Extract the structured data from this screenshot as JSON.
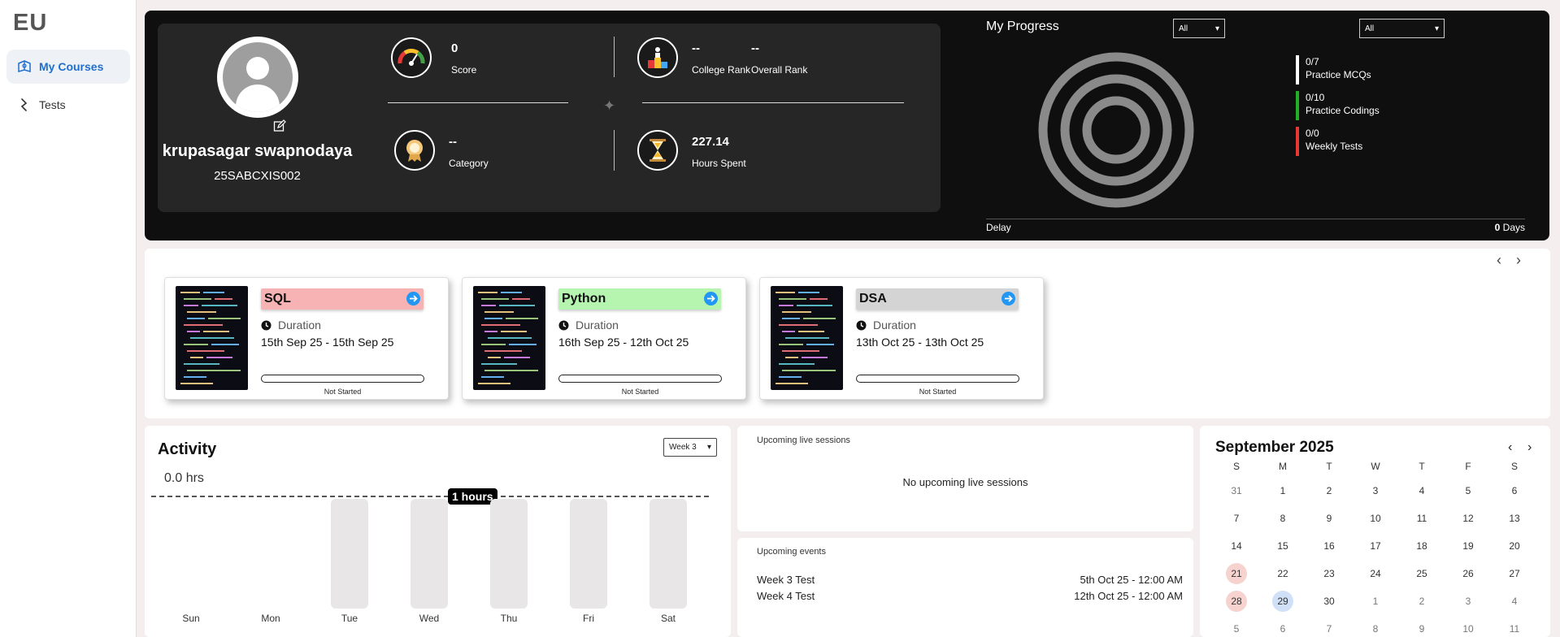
{
  "brand": {
    "logo": "EU"
  },
  "sidebar": {
    "items": [
      {
        "label": "My Courses",
        "icon": "book-icon",
        "active": true
      },
      {
        "label": "Tests",
        "icon": "test-icon",
        "active": false
      }
    ]
  },
  "profile": {
    "name": "krupasagar swapnodaya",
    "id": "25SABCXIS002"
  },
  "stats": {
    "score": {
      "value": "0",
      "label": "Score",
      "icon": "speedometer-icon"
    },
    "college_rank": {
      "value": "--",
      "label": "College Rank",
      "icon": "podium-icon"
    },
    "overall_rank": {
      "value": "--",
      "label": "Overall Rank"
    },
    "category": {
      "value": "--",
      "label": "Category",
      "icon": "medal-icon"
    },
    "hours": {
      "value": "227.14",
      "label": "Hours Spent",
      "icon": "hourglass-icon"
    }
  },
  "progress": {
    "title": "My Progress",
    "filter1": "All",
    "filter2": "All",
    "legend": [
      {
        "value": "0/7",
        "label": "Practice MCQs",
        "color": "#ffffff"
      },
      {
        "value": "0/10",
        "label": "Practice Codings",
        "color": "#22b022"
      },
      {
        "value": "0/0",
        "label": "Weekly Tests",
        "color": "#e53935"
      }
    ],
    "delay_label": "Delay",
    "delay_value": "0",
    "delay_unit": "Days"
  },
  "courses": [
    {
      "title": "SQL",
      "color": "#f7b3b3",
      "duration_label": "Duration",
      "dates": "15th Sep 25 - 15th Sep 25",
      "progress": 0,
      "status": "Not Started"
    },
    {
      "title": "Python",
      "color": "#b6f5b0",
      "duration_label": "Duration",
      "dates": "16th Sep 25 - 12th Oct 25",
      "progress": 0,
      "status": "Not Started"
    },
    {
      "title": "DSA",
      "color": "#d4d4d4",
      "duration_label": "Duration",
      "dates": "13th Oct 25 - 13th Oct 25",
      "progress": 0,
      "status": "Not Started"
    }
  ],
  "activity": {
    "title": "Activity",
    "total": "0.0 hrs",
    "week": "Week 3",
    "max_tag": "1 hours",
    "days": [
      {
        "label": "Sun",
        "has_bar": false
      },
      {
        "label": "Mon",
        "has_bar": false
      },
      {
        "label": "Tue",
        "has_bar": true
      },
      {
        "label": "Wed",
        "has_bar": true
      },
      {
        "label": "Thu",
        "has_bar": true
      },
      {
        "label": "Fri",
        "has_bar": true
      },
      {
        "label": "Sat",
        "has_bar": true
      }
    ]
  },
  "sessions": {
    "header": "Upcoming live sessions",
    "empty": "No upcoming live sessions"
  },
  "events": {
    "header": "Upcoming events",
    "items": [
      {
        "name": "Week 3 Test",
        "date": "5th Oct 25 - 12:00 AM"
      },
      {
        "name": "Week 4 Test",
        "date": "12th Oct 25 - 12:00 AM"
      }
    ]
  },
  "calendar": {
    "title": "September 2025",
    "weekdays": [
      "S",
      "M",
      "T",
      "W",
      "T",
      "F",
      "S"
    ],
    "weeks": [
      [
        "31",
        "1",
        "2",
        "3",
        "4",
        "5",
        "6"
      ],
      [
        "7",
        "8",
        "9",
        "10",
        "11",
        "12",
        "13"
      ],
      [
        "14",
        "15",
        "16",
        "17",
        "18",
        "19",
        "20"
      ],
      [
        "21",
        "22",
        "23",
        "24",
        "25",
        "26",
        "27"
      ],
      [
        "28",
        "29",
        "30",
        "1",
        "2",
        "3",
        "4"
      ],
      [
        "5",
        "6",
        "7",
        "8",
        "9",
        "10",
        "11"
      ]
    ],
    "highlight_red": [
      "21",
      "28"
    ],
    "highlight_blue": [
      "29"
    ]
  }
}
